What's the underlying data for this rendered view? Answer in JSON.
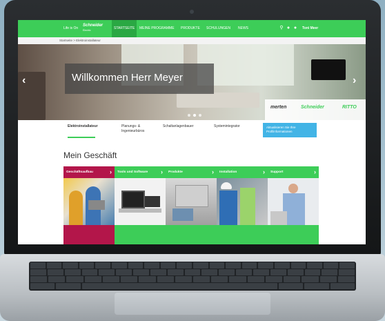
{
  "topnav": {
    "life_is_on": "Life is On",
    "brand_name": "Schneider",
    "brand_sub": "Electric",
    "items": [
      "STARTSEITE",
      "MEINE PROGRAMME",
      "PRODUKTE",
      "SCHULUNGEN",
      "NEWS"
    ],
    "user_name": "Toni Meer"
  },
  "breadcrumb": {
    "text": "Startseite > Elektroinstallateur"
  },
  "hero": {
    "title": "Willkommen Herr Meyer",
    "brands": [
      "merten",
      "Schneider",
      "RITTO"
    ]
  },
  "tabs": {
    "items": [
      "Elektroinstallateur",
      "Planungs- &\nIngenieurbüros",
      "Schaltanlagenbauer",
      "Systemintegrator"
    ],
    "active_index": 0,
    "update_button": "Aktualisieren Sie Ihre Profilinformationen"
  },
  "section": {
    "title": "Mein Geschäft"
  },
  "tiles": [
    {
      "label": "Geschäftsaufbau",
      "color": "#b3164a"
    },
    {
      "label": "Tools und Software",
      "color": "#3dcd58"
    },
    {
      "label": "Produkte",
      "color": "#3dcd58"
    },
    {
      "label": "Installation",
      "color": "#3dcd58"
    },
    {
      "label": "Support",
      "color": "#3dcd58"
    }
  ],
  "colors": {
    "accent": "#3dcd58",
    "accent_dark": "#2aa843",
    "highlight": "#b3164a",
    "info": "#42b4e6"
  }
}
